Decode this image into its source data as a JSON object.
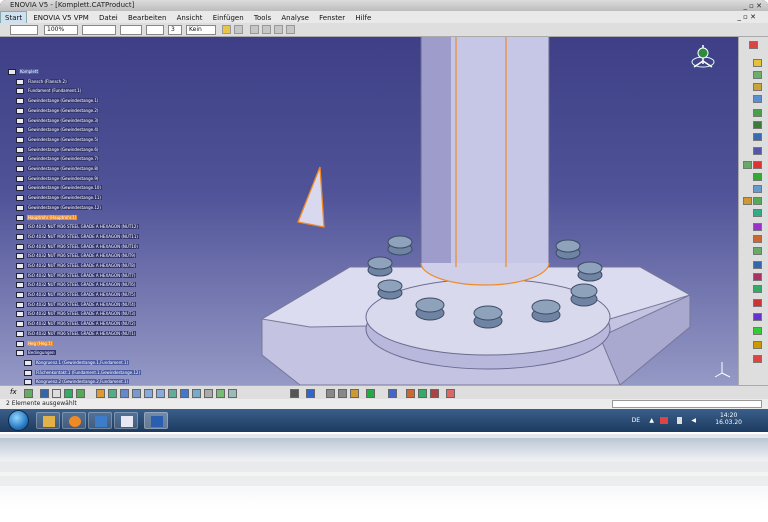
{
  "window": {
    "title": "ENOVIA V5 - [Komplett.CATProduct]",
    "controls": "_ ▫ ✕",
    "doc_controls": "_ ▫ ✕"
  },
  "menu": [
    "Start",
    "ENOVIA V5 VPM",
    "Datei",
    "Bearbeiten",
    "Ansicht",
    "Einfügen",
    "Tools",
    "Analyse",
    "Fenster",
    "Hilfe"
  ],
  "toolbar": {
    "zoom": "100%",
    "line_weight": "3",
    "layer": "Kein"
  },
  "tree": [
    {
      "label": "Komplett",
      "level": 0,
      "state": "hl"
    },
    {
      "label": "Flansch (Flansch.2)",
      "level": 1,
      "state": ""
    },
    {
      "label": "Fundament (Fundament.1)",
      "level": 1,
      "state": ""
    },
    {
      "label": "Gewindestange (Gewindestange.1)",
      "level": 1,
      "state": ""
    },
    {
      "label": "Gewindestange (Gewindestange.2)",
      "level": 1,
      "state": ""
    },
    {
      "label": "Gewindestange (Gewindestange.3)",
      "level": 1,
      "state": ""
    },
    {
      "label": "Gewindestange (Gewindestange.4)",
      "level": 1,
      "state": ""
    },
    {
      "label": "Gewindestange (Gewindestange.5)",
      "level": 1,
      "state": ""
    },
    {
      "label": "Gewindestange (Gewindestange.6)",
      "level": 1,
      "state": ""
    },
    {
      "label": "Gewindestange (Gewindestange.7)",
      "level": 1,
      "state": ""
    },
    {
      "label": "Gewindestange (Gewindestange.8)",
      "level": 1,
      "state": ""
    },
    {
      "label": "Gewindestange (Gewindestange.9)",
      "level": 1,
      "state": ""
    },
    {
      "label": "Gewindestange (Gewindestange.10)",
      "level": 1,
      "state": ""
    },
    {
      "label": "Gewindestange (Gewindestange.11)",
      "level": 1,
      "state": ""
    },
    {
      "label": "Gewindestange (Gewindestange.12)",
      "level": 1,
      "state": ""
    },
    {
      "label": "Hauptrohr (Hauptrohr.1)",
      "level": 1,
      "state": "sel"
    },
    {
      "label": "ISO 4032 NUT M36 STEEL GRADE A HEXAGON (NUT12)",
      "level": 1,
      "state": ""
    },
    {
      "label": "ISO 4032 NUT M36 STEEL GRADE A HEXAGON (NUT11)",
      "level": 1,
      "state": ""
    },
    {
      "label": "ISO 4032 NUT M36 STEEL GRADE A HEXAGON (NUT10)",
      "level": 1,
      "state": ""
    },
    {
      "label": "ISO 4032 NUT M36 STEEL GRADE A HEXAGON (NUT9)",
      "level": 1,
      "state": ""
    },
    {
      "label": "ISO 4032 NUT M36 STEEL GRADE A HEXAGON (NUT8)",
      "level": 1,
      "state": ""
    },
    {
      "label": "ISO 4032 NUT M36 STEEL GRADE A HEXAGON (NUT7)",
      "level": 1,
      "state": ""
    },
    {
      "label": "ISO 4032 NUT M36 STEEL GRADE A HEXAGON (NUT6)",
      "level": 1,
      "state": ""
    },
    {
      "label": "ISO 4032 NUT M36 STEEL GRADE A HEXAGON (NUT5)",
      "level": 1,
      "state": ""
    },
    {
      "label": "ISO 4032 NUT M36 STEEL GRADE A HEXAGON (NUT4)",
      "level": 1,
      "state": ""
    },
    {
      "label": "ISO 4032 NUT M36 STEEL GRADE A HEXAGON (NUT3)",
      "level": 1,
      "state": ""
    },
    {
      "label": "ISO 4032 NUT M36 STEEL GRADE A HEXAGON (NUT2)",
      "level": 1,
      "state": ""
    },
    {
      "label": "ISO 4032 NUT M36 STEEL GRADE A HEXAGON (NUT1)",
      "level": 1,
      "state": ""
    },
    {
      "label": "Heg (Heg.1)",
      "level": 1,
      "state": "sel"
    },
    {
      "label": "Bedingungen",
      "level": 1,
      "state": ""
    },
    {
      "label": "Kongruenz.1 (Gewindestange.1,Fundament.1)",
      "level": 2,
      "state": "hl"
    },
    {
      "label": "Flächenkontakt.1 (Fundament.1,Gewindestange.12)",
      "level": 2,
      "state": "hl"
    },
    {
      "label": "Kongruenz.2 (Gewindestange.2,Fundament.1)",
      "level": 2,
      "state": "hl"
    }
  ],
  "status": {
    "message": "2 Elemente ausgewählt"
  },
  "tray": {
    "lang": "DE",
    "time": "14:20",
    "date": "16.03.20"
  },
  "colors": {
    "viewport_top": "#3e3f86",
    "viewport_bottom": "#9599c5",
    "selection": "#f08a24",
    "part": "#c9c9e8"
  }
}
